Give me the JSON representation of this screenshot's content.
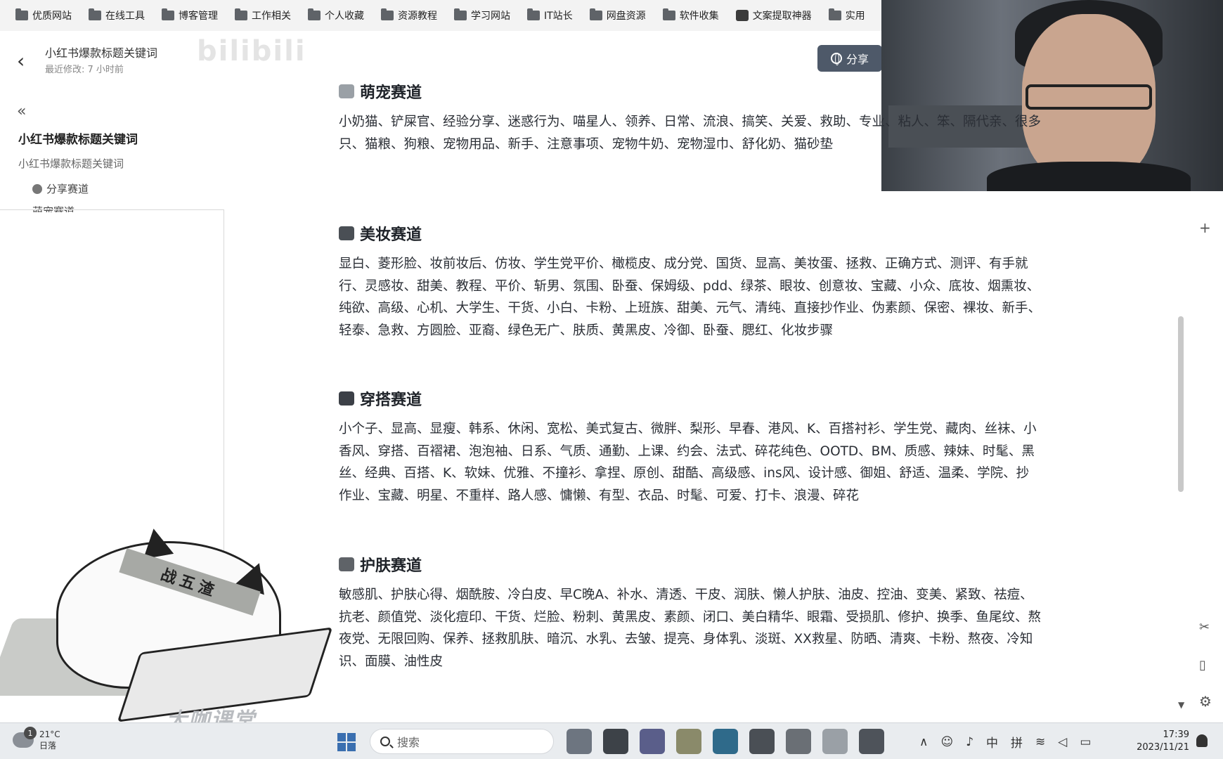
{
  "bookmarks": [
    {
      "label": "优质网站",
      "icon": "folder-icon"
    },
    {
      "label": "在线工具",
      "icon": "folder-icon"
    },
    {
      "label": "博客管理",
      "icon": "folder-icon"
    },
    {
      "label": "工作相关",
      "icon": "folder-icon"
    },
    {
      "label": "个人收藏",
      "icon": "folder-icon"
    },
    {
      "label": "资源教程",
      "icon": "folder-icon"
    },
    {
      "label": "学习网站",
      "icon": "folder-icon"
    },
    {
      "label": "IT站长",
      "icon": "folder-icon"
    },
    {
      "label": "网盘资源",
      "icon": "folder-icon"
    },
    {
      "label": "软件收集",
      "icon": "folder-icon"
    },
    {
      "label": "文案提取神器",
      "icon": "app-icon"
    },
    {
      "label": "实用",
      "icon": "folder-icon"
    }
  ],
  "doc": {
    "title": "小红书爆款标题关键词",
    "last_modified": "最近修改: 7 小时前",
    "watermark": "bilibili",
    "share_label": "分享"
  },
  "sidebar": {
    "collapse_glyph": "«",
    "title": "小红书爆款标题关键词",
    "subtitle": "小红书爆款标题关键词",
    "items": [
      {
        "label": "分享赛道"
      },
      {
        "label": "萌宠赛道"
      }
    ]
  },
  "sections": [
    {
      "title": "萌宠赛道",
      "emoji_color": "#9aa0a6",
      "keywords": "小奶猫、铲屎官、经验分享、迷惑行为、喵星人、领养、日常、流浪、搞笑、关爱、救助、专业、粘人、笨、隔代亲、很多只、猫粮、狗粮、宠物用品、新手、注意事项、宠物牛奶、宠物湿巾、舒化奶、猫砂垫"
    },
    {
      "title": "美妆赛道",
      "emoji_color": "#4a4f55",
      "keywords": "显白、菱形脸、妆前妆后、仿妆、学生党平价、橄榄皮、成分党、国货、显高、美妆蛋、拯救、正确方式、测评、有手就行、灵感妆、甜美、教程、平价、斩男、氛围、卧蚕、保姆级、pdd、绿茶、眼妆、创意妆、宝藏、小众、底妆、烟熏妆、纯欲、高级、心机、大学生、干货、小白、卡粉、上班族、甜美、元气、清纯、直接抄作业、伪素颜、保密、裸妆、新手、轻泰、急救、方圆脸、亚裔、绿色无广、肤质、黄黑皮、冷御、卧蚕、腮红、化妆步骤"
    },
    {
      "title": "穿搭赛道",
      "emoji_color": "#3c4047",
      "keywords": "小个子、显高、显瘦、韩系、休闲、宽松、美式复古、微胖、梨形、早春、港风、K、百搭衬衫、学生党、藏肉、丝袜、小香风、穿搭、百褶裙、泡泡袖、日系、气质、通勤、上课、约会、法式、碎花纯色、OOTD、BM、质感、辣妹、时髦、黑丝、经典、百搭、K、软妹、优雅、不撞衫、拿捏、原创、甜酷、高级感、ins风、设计感、御姐、舒适、温柔、学院、抄作业、宝藏、明星、不重样、路人感、慵懒、有型、衣品、时髦、可爱、打卡、浪漫、碎花"
    },
    {
      "title": "护肤赛道",
      "emoji_color": "#5f6368",
      "keywords": "敏感肌、护肤心得、烟酰胺、冷白皮、早C晚A、补水、清透、干皮、润肤、懒人护肤、油皮、控油、变美、紧致、祛痘、抗老、颜值党、淡化痘印、干货、烂脸、粉刺、黄黑皮、素颜、闭口、美白精华、眼霜、受损肌、修护、换季、鱼尾纹、熬夜党、无限回购、保养、拯救肌肤、暗沉、水乳、去皱、提亮、身体乳、淡斑、XX救星、防晒、清爽、卡粉、熬夜、冷知识、面膜、油性皮"
    }
  ],
  "overlay": {
    "headband_text": "战五渣",
    "logo_text": "大咖课堂"
  },
  "taskbar": {
    "weather_badge": "1",
    "temperature": "21°C",
    "weather_desc": "日落",
    "search_placeholder": "搜索",
    "ime_lang": "中",
    "ime_mode": "拼",
    "time": "17:39",
    "date": "2023/11/21"
  }
}
